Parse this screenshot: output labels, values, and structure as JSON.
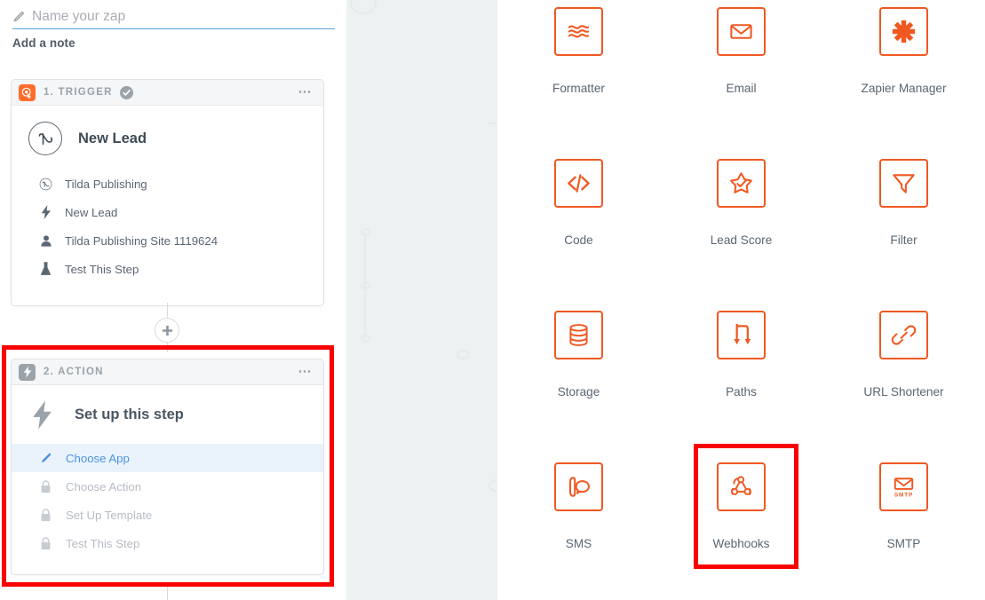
{
  "editor": {
    "zap_name_value": "",
    "zap_name_placeholder": "Name your zap",
    "pencil_icon": "pencil-icon",
    "add_note_label": "Add a note"
  },
  "trigger_step": {
    "header_label": "1. TRIGGER",
    "badge_icon": "zapier-trigger-icon",
    "status_icon": "check-circle-icon",
    "menu_icon": "ellipsis-icon",
    "app_avatar_icon": "tilda-icon",
    "app_name": "New Lead",
    "details": [
      {
        "icon": "tilda-circle-icon",
        "label": "Tilda Publishing"
      },
      {
        "icon": "lightning-icon",
        "label": "New Lead"
      },
      {
        "icon": "person-icon",
        "label": "Tilda Publishing Site 1119624"
      },
      {
        "icon": "flask-icon",
        "label": "Test This Step"
      }
    ]
  },
  "add_step": {
    "icon": "plus-icon",
    "label": ""
  },
  "action_step": {
    "header_label": "2. ACTION",
    "badge_icon": "lightning-icon",
    "menu_icon": "ellipsis-icon",
    "setup_title_icon": "lightning-icon",
    "setup_title": "Set up this step",
    "setup_rows": [
      {
        "icon": "pencil-icon",
        "label": "Choose App",
        "state": "active"
      },
      {
        "icon": "lock-icon",
        "label": "Choose Action",
        "state": "locked"
      },
      {
        "icon": "lock-icon",
        "label": "Set Up Template",
        "state": "locked"
      },
      {
        "icon": "lock-icon",
        "label": "Test This Step",
        "state": "locked"
      }
    ]
  },
  "app_grid": {
    "apps": [
      {
        "label": "Formatter",
        "icon": "formatter-waves-icon",
        "highlighted": false
      },
      {
        "label": "Email",
        "icon": "envelope-icon",
        "highlighted": false
      },
      {
        "label": "Zapier Manager",
        "icon": "zapier-asterisk-icon",
        "highlighted": false
      },
      {
        "label": "Code",
        "icon": "code-brackets-icon",
        "highlighted": false
      },
      {
        "label": "Lead Score",
        "icon": "star-check-icon",
        "highlighted": false
      },
      {
        "label": "Filter",
        "icon": "funnel-icon",
        "highlighted": false
      },
      {
        "label": "Storage",
        "icon": "database-icon",
        "highlighted": false
      },
      {
        "label": "Paths",
        "icon": "paths-branch-icon",
        "highlighted": false
      },
      {
        "label": "URL Shortener",
        "icon": "link-chain-icon",
        "highlighted": false
      },
      {
        "label": "SMS",
        "icon": "phone-chat-icon",
        "highlighted": false
      },
      {
        "label": "Webhooks",
        "icon": "webhook-icon",
        "highlighted": true
      },
      {
        "label": "SMTP",
        "icon": "envelope-smtp-icon",
        "highlighted": false
      }
    ],
    "smtp_badge_text": "SMTP"
  },
  "colors": {
    "zapier_orange": "#ff6d2c",
    "tile_orange": "#f05822",
    "highlight_red": "#fb0000",
    "active_blue": "#4b93e3",
    "active_blue_bg": "#eaf3fc",
    "muted_gray": "#9aa3aa",
    "text_gray": "#5a6672",
    "panel_gray": "#eef1f2"
  }
}
